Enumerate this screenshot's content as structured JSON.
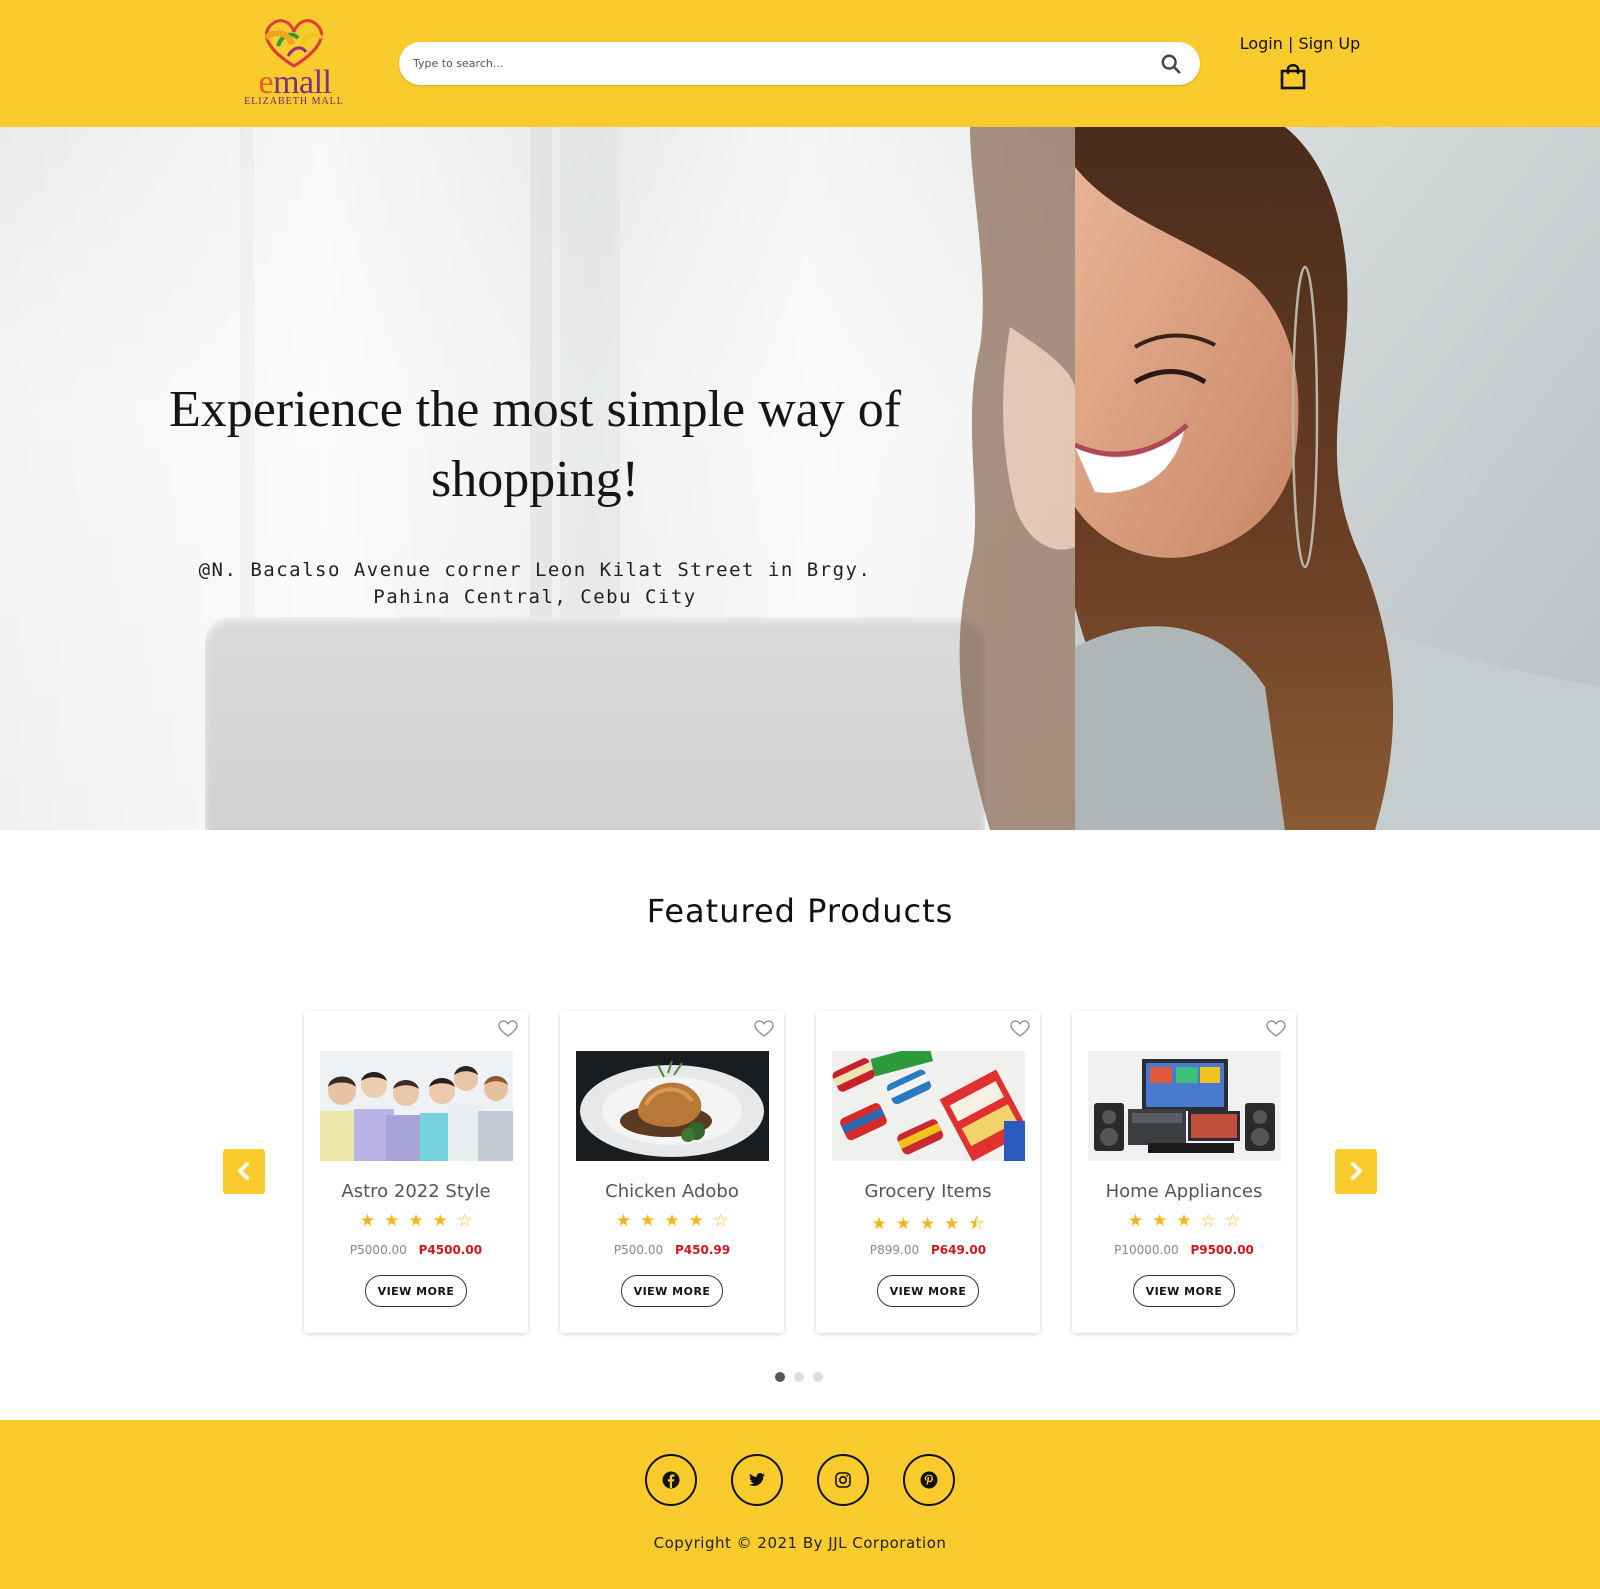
{
  "header": {
    "logo_word": "mall",
    "logo_letter": "e",
    "logo_sub": "ELIZABETH MALL",
    "search_placeholder": "Type to search...",
    "login_label": "Login",
    "separator": "|",
    "signup_label": "Sign Up",
    "brand_color": "#F9CB2C"
  },
  "hero": {
    "title": "Experience the most simple way of shopping!",
    "address_line1": "@N. Bacalso Avenue corner Leon Kilat Street in Brgy.",
    "address_line2": "Pahina Central, Cebu City"
  },
  "featured": {
    "title": "Featured Products",
    "products": [
      {
        "name": "Astro 2022 Style",
        "rating": 4,
        "stars": "★★★★☆",
        "old_price": "P5000.00",
        "new_price": "P4500.00",
        "button": "VIEW MORE",
        "image": "group-photo"
      },
      {
        "name": "Chicken Adobo",
        "rating": 4,
        "stars": "★★★★☆",
        "old_price": "P500.00",
        "new_price": "P450.99",
        "button": "VIEW MORE",
        "image": "food-plate"
      },
      {
        "name": "Grocery Items",
        "rating": 4.5,
        "stars": "★★★★⯪",
        "old_price": "P899.00",
        "new_price": "P649.00",
        "button": "VIEW MORE",
        "image": "grocery-cans"
      },
      {
        "name": "Home Appliances",
        "rating": 3,
        "stars": "★★★☆☆",
        "old_price": "P10000.00",
        "new_price": "P9500.00",
        "button": "VIEW MORE",
        "image": "appliances"
      }
    ],
    "carousel_pages": 3,
    "active_page": 1
  },
  "footer": {
    "social_icons": [
      "facebook-icon",
      "twitter-icon",
      "instagram-icon",
      "pinterest-icon"
    ],
    "copyright": "Copyright © 2021 By JJL Corporation"
  }
}
